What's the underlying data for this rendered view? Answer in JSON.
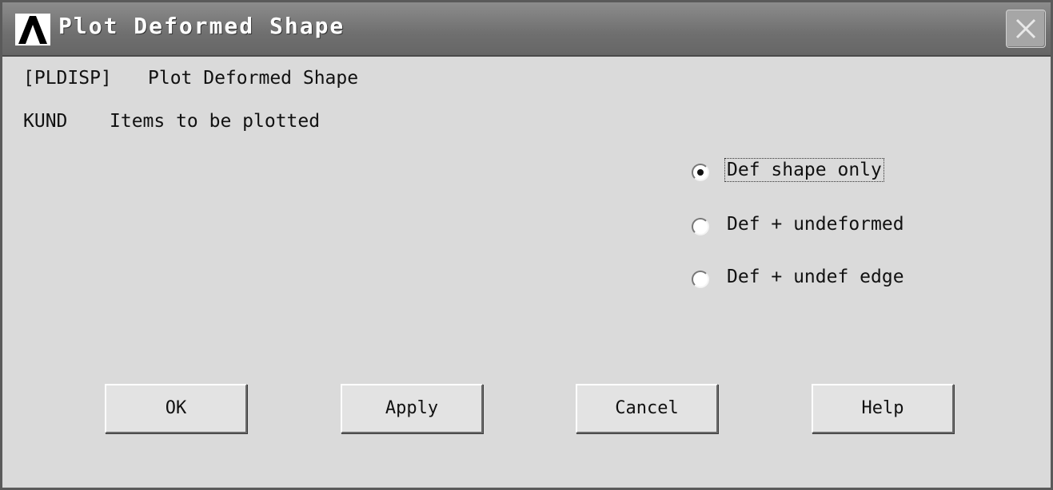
{
  "window": {
    "title": "Plot Deformed Shape",
    "logo_icon": "ansys-logo-icon",
    "close_icon": "close-icon"
  },
  "command": {
    "name": "[PLDISP]",
    "description": "Plot Deformed Shape"
  },
  "option": {
    "key": "KUND",
    "description": "Items to be plotted",
    "choices": [
      {
        "label": "Def shape only",
        "selected": true
      },
      {
        "label": "Def + undeformed",
        "selected": false
      },
      {
        "label": "Def + undef edge",
        "selected": false
      }
    ]
  },
  "buttons": {
    "ok": "OK",
    "apply": "Apply",
    "cancel": "Cancel",
    "help": "Help"
  }
}
